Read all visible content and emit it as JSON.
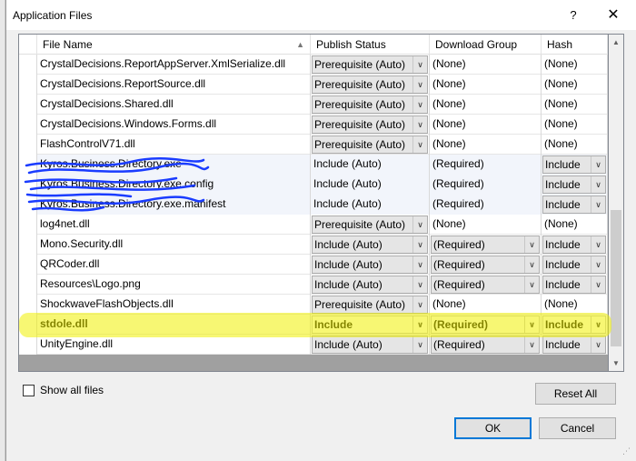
{
  "dialog": {
    "title": "Application Files",
    "help_label": "?",
    "close_label": "✕"
  },
  "grid": {
    "columns": [
      "File Name",
      "Publish Status",
      "Download Group",
      "Hash"
    ],
    "rows": [
      {
        "file": "CrystalDecisions.ReportAppServer.XmlSerialize.dll",
        "status": "Prerequisite (Auto)",
        "group": "(None)",
        "hash": "(None)",
        "status_combo": true,
        "group_combo": false,
        "hash_combo": false,
        "tinted": false,
        "bold": false
      },
      {
        "file": "CrystalDecisions.ReportSource.dll",
        "status": "Prerequisite (Auto)",
        "group": "(None)",
        "hash": "(None)",
        "status_combo": true,
        "group_combo": false,
        "hash_combo": false,
        "tinted": false,
        "bold": false
      },
      {
        "file": "CrystalDecisions.Shared.dll",
        "status": "Prerequisite (Auto)",
        "group": "(None)",
        "hash": "(None)",
        "status_combo": true,
        "group_combo": false,
        "hash_combo": false,
        "tinted": false,
        "bold": false
      },
      {
        "file": "CrystalDecisions.Windows.Forms.dll",
        "status": "Prerequisite (Auto)",
        "group": "(None)",
        "hash": "(None)",
        "status_combo": true,
        "group_combo": false,
        "hash_combo": false,
        "tinted": false,
        "bold": false
      },
      {
        "file": "FlashControlV71.dll",
        "status": "Prerequisite (Auto)",
        "group": "(None)",
        "hash": "(None)",
        "status_combo": true,
        "group_combo": false,
        "hash_combo": false,
        "tinted": false,
        "bold": false
      },
      {
        "file": "Kyros.Business.Directory.exe",
        "status": "Include (Auto)",
        "group": "(Required)",
        "hash": "Include",
        "status_combo": false,
        "group_combo": false,
        "hash_combo": true,
        "tinted": true,
        "bold": false
      },
      {
        "file": "Kyros.Business.Directory.exe.config",
        "status": "Include (Auto)",
        "group": "(Required)",
        "hash": "Include",
        "status_combo": false,
        "group_combo": false,
        "hash_combo": true,
        "tinted": true,
        "bold": false
      },
      {
        "file": "Kyros.Business.Directory.exe.manifest",
        "status": "Include (Auto)",
        "group": "(Required)",
        "hash": "Include",
        "status_combo": false,
        "group_combo": false,
        "hash_combo": true,
        "tinted": true,
        "bold": false
      },
      {
        "file": "log4net.dll",
        "status": "Prerequisite (Auto)",
        "group": "(None)",
        "hash": "(None)",
        "status_combo": true,
        "group_combo": false,
        "hash_combo": false,
        "tinted": false,
        "bold": false
      },
      {
        "file": "Mono.Security.dll",
        "status": "Include (Auto)",
        "group": "(Required)",
        "hash": "Include",
        "status_combo": true,
        "group_combo": true,
        "hash_combo": true,
        "tinted": false,
        "bold": false
      },
      {
        "file": "QRCoder.dll",
        "status": "Include (Auto)",
        "group": "(Required)",
        "hash": "Include",
        "status_combo": true,
        "group_combo": true,
        "hash_combo": true,
        "tinted": false,
        "bold": false
      },
      {
        "file": "Resources\\Logo.png",
        "status": "Include (Auto)",
        "group": "(Required)",
        "hash": "Include",
        "status_combo": true,
        "group_combo": true,
        "hash_combo": true,
        "tinted": false,
        "bold": false
      },
      {
        "file": "ShockwaveFlashObjects.dll",
        "status": "Prerequisite (Auto)",
        "group": "(None)",
        "hash": "(None)",
        "status_combo": true,
        "group_combo": false,
        "hash_combo": false,
        "tinted": false,
        "bold": false
      },
      {
        "file": "stdole.dll",
        "status": "Include",
        "group": "(Required)",
        "hash": "Include",
        "status_combo": true,
        "group_combo": true,
        "hash_combo": true,
        "tinted": false,
        "bold": true
      },
      {
        "file": "UnityEngine.dll",
        "status": "Include (Auto)",
        "group": "(Required)",
        "hash": "Include",
        "status_combo": true,
        "group_combo": true,
        "hash_combo": true,
        "tinted": false,
        "bold": false
      }
    ]
  },
  "show_all_files_label": "Show all files",
  "buttons": {
    "reset_all": "Reset All",
    "ok": "OK",
    "cancel": "Cancel"
  },
  "colors": {
    "highlight": "#f0f000",
    "scribble": "#1a3cff",
    "ok_border": "#0078d7"
  }
}
